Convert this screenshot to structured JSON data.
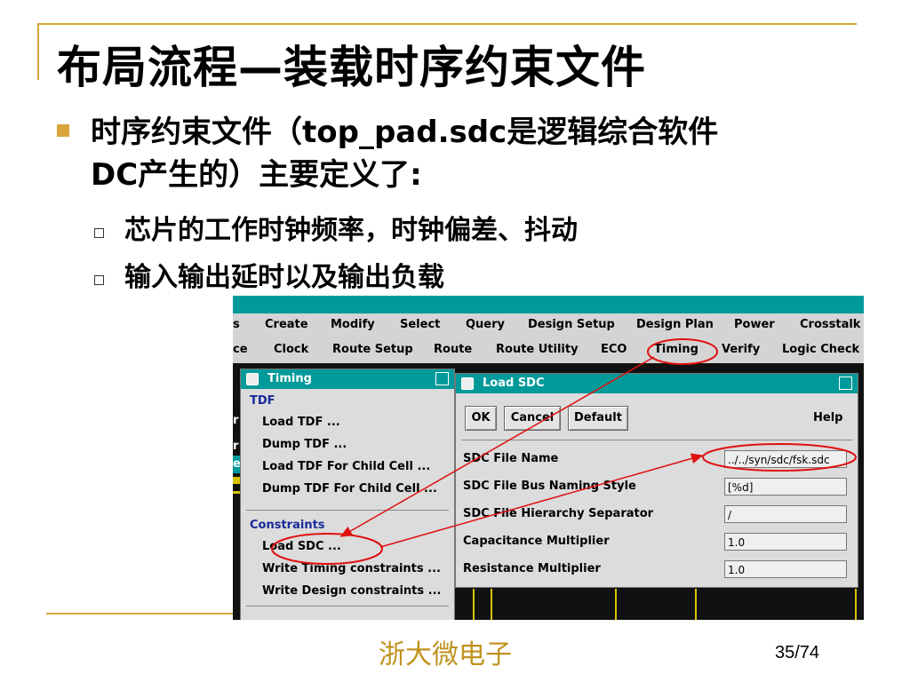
{
  "title": "布局流程—装载时序约束文件",
  "bullet1": {
    "line1": "时序约束文件（top_pad.sdc是逻辑综合软件",
    "line2": "DC产生的）主要定义了:"
  },
  "subbullets": [
    "芯片的工作时钟频率，时钟偏差、抖动",
    "输入输出延时以及输出负载"
  ],
  "footer": {
    "org": "浙大微电子",
    "page": "35/74"
  },
  "menubar1": [
    "s",
    "Create",
    "Modify",
    "Select",
    "Query",
    "Design Setup",
    "Design Plan",
    "Power",
    "Crosstalk"
  ],
  "menubar2": [
    "ce",
    "Clock",
    "Route Setup",
    "Route",
    "Route Utility",
    "ECO",
    "Timing",
    "Verify",
    "Logic Check"
  ],
  "timing_menu": {
    "title": "Timing",
    "tdf_header": "TDF",
    "tdf_items": [
      "Load TDF ...",
      "Dump TDF ...",
      "Load TDF For Child Cell ...",
      "Dump TDF For Child Cell ..."
    ],
    "constraints_header": "Constraints",
    "constraints_items": [
      "Load SDC ...",
      "Write Timing constraints ...",
      "Write Design constraints ..."
    ]
  },
  "load_sdc": {
    "title": "Load SDC",
    "buttons": {
      "ok": "OK",
      "cancel": "Cancel",
      "default": "Default",
      "help": "Help"
    },
    "fields": [
      {
        "label": "SDC File Name",
        "value": "../../syn/sdc/fsk.sdc"
      },
      {
        "label": "SDC File Bus Naming Style",
        "value": "[%d]"
      },
      {
        "label": "SDC File Hierarchy Separator",
        "value": "/"
      },
      {
        "label": "Capacitance Multiplier",
        "value": "1.0"
      },
      {
        "label": "Resistance Multiplier",
        "value": "1.0"
      }
    ]
  },
  "side_letters": [
    "r",
    "r",
    "e"
  ],
  "colors": {
    "accent": "#d8a63a",
    "teal": "#009a9a",
    "annotation": "#e01010",
    "footer_text": "#c0921e"
  }
}
